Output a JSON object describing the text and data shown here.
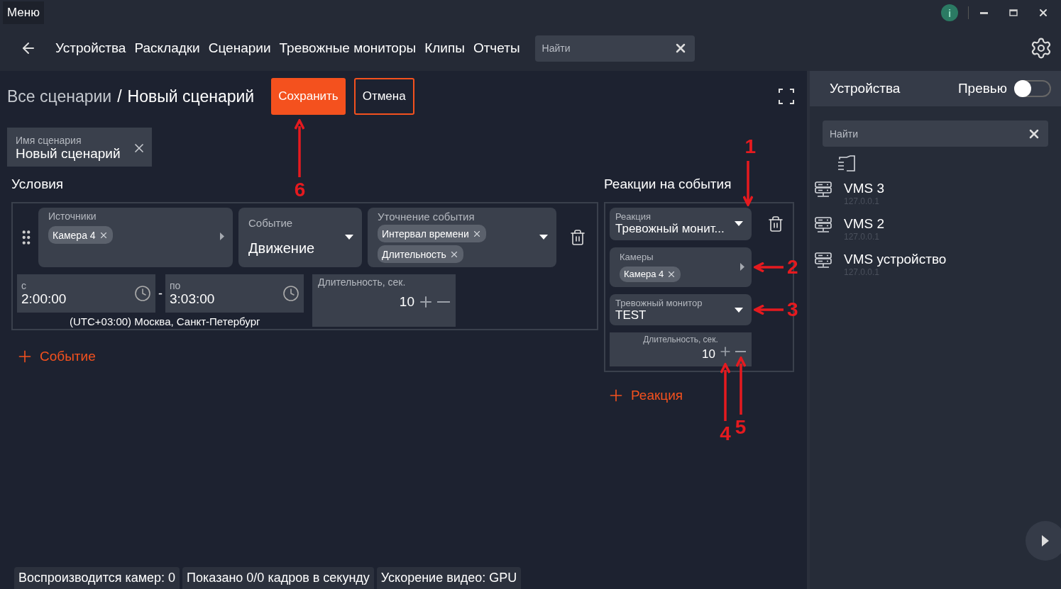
{
  "window": {
    "menu": "Меню",
    "info": "i"
  },
  "nav": {
    "items": [
      "Устройства",
      "Раскладки",
      "Сценарии",
      "Тревожные мониторы",
      "Клипы",
      "Отчеты"
    ],
    "search": {
      "placeholder": "Найти"
    }
  },
  "header": {
    "breadcrumb": "Все сценарии",
    "separator": "/",
    "title": "Новый сценарий",
    "save": {
      "label": "Сохранить",
      "callout": {
        "label": "6",
        "kind": "bottom"
      }
    },
    "cancel": "Отмена"
  },
  "name_field": {
    "label": "Имя сценария",
    "value": "Новый сценарий"
  },
  "conditions": {
    "title": "Условия",
    "sources": {
      "label": "Источники",
      "chips": [
        "Камера 4"
      ]
    },
    "event": {
      "label": "Событие",
      "value": "Движение"
    },
    "refine": {
      "label": "Уточнение события",
      "chips": [
        "Интервал времени",
        "Длительность"
      ]
    },
    "from": {
      "label": "с",
      "value": "2:00:00"
    },
    "dash": "-",
    "to": {
      "label": "по",
      "value": "3:03:00"
    },
    "timezone": "(UTC+03:00) Москва, Санкт-Петербург",
    "duration": {
      "label": "Длительность, сек.",
      "value": "10"
    }
  },
  "add_event": "Событие",
  "reactions": {
    "title": "Реакции на события",
    "reaction": {
      "label": "Реакция",
      "value": "Тревожный монит...",
      "callout": {
        "label": "1",
        "kind": "top"
      }
    },
    "cameras": {
      "label": "Камеры",
      "chips": [
        "Камера 4"
      ],
      "callout": {
        "label": "2",
        "kind": "right"
      }
    },
    "monitor": {
      "label": "Тревожный монитор",
      "value": "TEST",
      "callout": {
        "label": "3",
        "kind": "right"
      }
    },
    "duration": {
      "label": "Длительность, сек.",
      "value": "10",
      "plus_callout": {
        "label": "4",
        "kind": "bottom"
      },
      "minus_callout": {
        "label": "5",
        "kind": "bottom"
      }
    }
  },
  "add_reaction": "Реакция",
  "sidebar": {
    "title": "Устройства",
    "preview": {
      "label": "Превью",
      "on": false
    },
    "search": {
      "placeholder": "Найти"
    },
    "devices": [
      {
        "name": "VMS 3",
        "address": "127.0.0.1"
      },
      {
        "name": "VMS 2",
        "address": "127.0.0.1"
      },
      {
        "name": "VMS устройство",
        "address": "127.0.0.1"
      }
    ]
  },
  "status_bar": [
    "Воспроизводится камер: 0",
    "Показано 0/0 кадров в секунду",
    "Ускорение видео: GPU"
  ]
}
